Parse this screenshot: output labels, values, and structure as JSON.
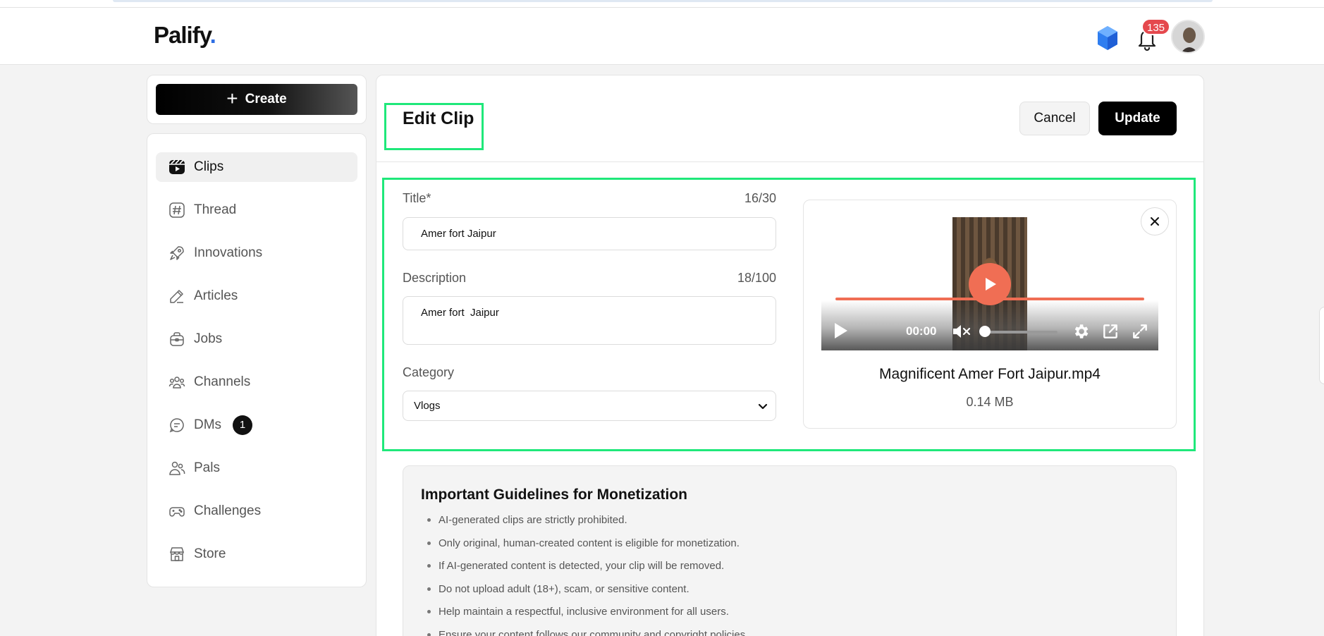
{
  "header": {
    "logo_text": "Palify",
    "logo_dot": ".",
    "notification_count": "135",
    "icons": {
      "gem": "gem-icon",
      "bell": "bell-icon",
      "avatar": "avatar"
    }
  },
  "sidebar": {
    "create_label": "Create",
    "items": [
      {
        "label": "Clips",
        "icon": "clips-icon",
        "active": true
      },
      {
        "label": "Thread",
        "icon": "hashtag-icon"
      },
      {
        "label": "Innovations",
        "icon": "rocket-icon"
      },
      {
        "label": "Articles",
        "icon": "pencil-icon"
      },
      {
        "label": "Jobs",
        "icon": "briefcase-icon"
      },
      {
        "label": "Channels",
        "icon": "group-icon"
      },
      {
        "label": "DMs",
        "icon": "chat-icon",
        "badge": "1"
      },
      {
        "label": "Pals",
        "icon": "people-icon"
      },
      {
        "label": "Challenges",
        "icon": "gamepad-icon"
      },
      {
        "label": "Store",
        "icon": "store-icon"
      }
    ]
  },
  "main": {
    "title": "Edit Clip",
    "cancel_label": "Cancel",
    "update_label": "Update",
    "form": {
      "title_label": "Title*",
      "title_count": "16/30",
      "title_value": "Amer fort Jaipur",
      "description_label": "Description",
      "description_count": "18/100",
      "description_value": "Amer fort  Jaipur",
      "category_label": "Category",
      "category_value": "Vlogs"
    },
    "preview": {
      "time": "00:00",
      "progress": 1.0,
      "volume": 0.0,
      "file_name": "Magnificent Amer Fort Jaipur.mp4",
      "file_size": "0.14 MB"
    },
    "guidelines": {
      "title": "Important Guidelines for Monetization",
      "items": [
        "AI-generated clips are strictly prohibited.",
        "Only original, human-created content is eligible for monetization.",
        "If AI-generated content is detected, your clip will be removed.",
        "Do not upload adult (18+), scam, or sensitive content.",
        "Help maintain a respectful, inclusive environment for all users.",
        "Ensure your content follows our community and copyright policies."
      ]
    }
  },
  "colors": {
    "accent_highlight": "#1fe87a",
    "video_accent": "#f06e54",
    "badge_red": "#e5484d",
    "logo_dot": "#2f6fe4"
  }
}
